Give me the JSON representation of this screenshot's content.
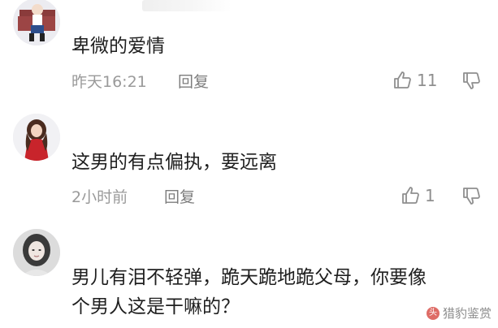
{
  "comments": [
    {
      "text": "卑微的爱情",
      "time": "昨天16:21",
      "reply_label": "回复",
      "likes": "11",
      "avatar_icon": "avatar-illustrated-person"
    },
    {
      "text": "这男的有点偏执，要远离",
      "time": "2小时前",
      "reply_label": "回复",
      "likes": "1",
      "avatar_icon": "avatar-woman-red-dress"
    },
    {
      "text_line1": "男儿有泪不轻弹，跪天跪地跪父母，你要像",
      "text_line2": "个男人这是干嘛的？",
      "avatar_icon": "avatar-woman-portrait"
    }
  ],
  "watermark": {
    "text": "猎豹鉴赏",
    "badge": "头"
  },
  "colors": {
    "text": "#1f1f1f",
    "meta": "#9a9a9a",
    "background": "#ffffff"
  }
}
